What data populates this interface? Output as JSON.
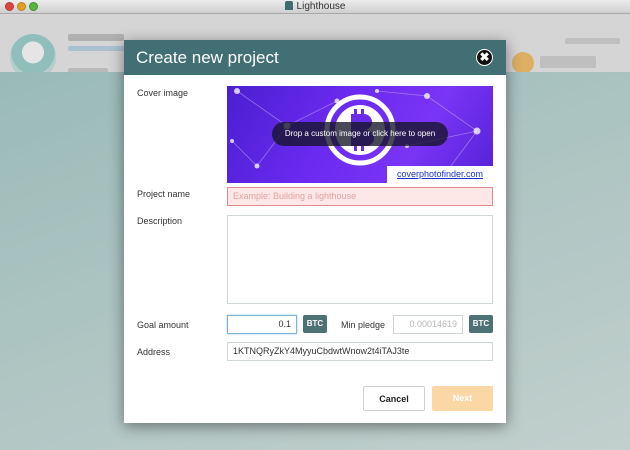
{
  "window": {
    "title": "Lighthouse"
  },
  "dialog": {
    "title": "Create new project",
    "close_glyph": "✖",
    "cover_label": "Cover image",
    "cover_drop_text": "Drop a custom image or click here to open",
    "cover_credit": "coverphotofinder.com",
    "project_name_label": "Project name",
    "project_name_placeholder": "Example: Building a lighthouse",
    "description_label": "Description",
    "goal_label": "Goal amount",
    "goal_value": "0.1",
    "goal_currency": "BTC",
    "min_pledge_label": "Min pledge",
    "min_pledge_placeholder": "0.00014619",
    "min_currency": "BTC",
    "address_label": "Address",
    "address_value": "1KTNQRyZkY4MyyuCbdwtWnow2t4iTAJ3te",
    "cancel_label": "Cancel",
    "next_label": "Next"
  },
  "colors": {
    "header": "#426f73",
    "btc_tag": "#4d7276",
    "next_disabled": "#fbd7a6",
    "error_border": "#e48a8a"
  },
  "icons": [
    "close-icon",
    "lighthouse-app-icon",
    "bitcoin-logo-icon"
  ]
}
